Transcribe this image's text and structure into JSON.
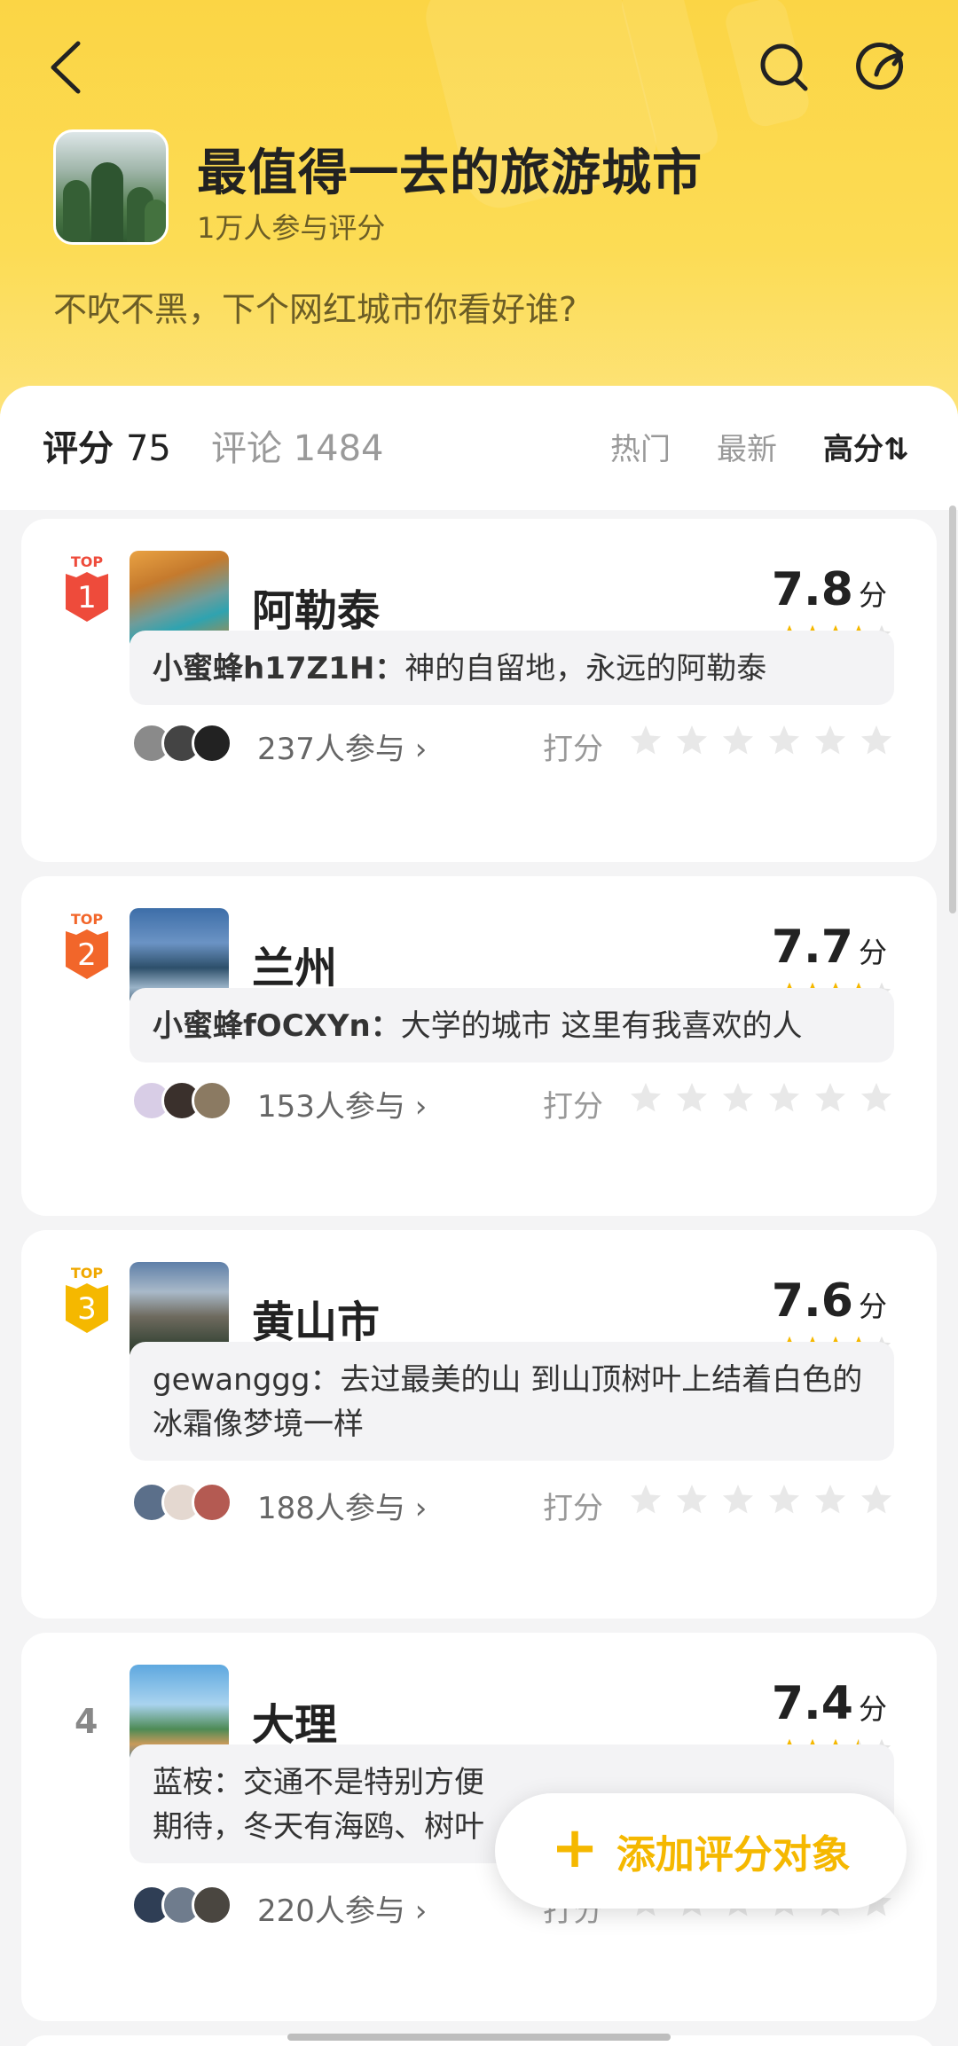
{
  "header": {
    "title": "最值得一去的旅游城市",
    "subtitle": "1万人参与评分",
    "description": "不吹不黑，下个网红城市你看好谁?",
    "icons": {
      "back": "back-arrow-icon",
      "search": "search-icon",
      "share": "share-icon"
    }
  },
  "tabs": {
    "rating_label": "评分",
    "rating_count": "75",
    "comment_label": "评论 1484"
  },
  "sort": {
    "hot": "热门",
    "new": "最新",
    "high": "高分⇅"
  },
  "items": [
    {
      "rank": "1",
      "rank_badge": "TOP",
      "name": "阿勒泰",
      "score": "7.8",
      "score_unit": "分",
      "comment_user": "小蜜蜂h17Z1H：",
      "comment_text": "神的自留地，永远的阿勒泰",
      "participants": "237人参与 ›",
      "rate_label": "打分",
      "star_rating": 4
    },
    {
      "rank": "2",
      "rank_badge": "TOP",
      "name": "兰州",
      "score": "7.7",
      "score_unit": "分",
      "comment_user": "小蜜蜂fOCXYn：",
      "comment_text": "大学的城市 这里有我喜欢的人",
      "participants": "153人参与 ›",
      "rate_label": "打分",
      "star_rating": 4
    },
    {
      "rank": "3",
      "rank_badge": "TOP",
      "name": "黄山市",
      "score": "7.6",
      "score_unit": "分",
      "comment_user": "gewanggg：",
      "comment_text": "去过最美的山 到山顶树叶上结着白色的冰霜像梦境一样",
      "participants": "188人参与 ›",
      "rate_label": "打分",
      "star_rating": 4
    },
    {
      "rank": "4",
      "name": "大理",
      "score": "7.4",
      "score_unit": "分",
      "comment_user": "蓝桉：",
      "comment_text": "交通不是特别方便……期待，冬天有海鸥、树叶……",
      "comment_line1": "交通不是特别方便",
      "comment_line2": "期待，冬天有海鸥、树叶",
      "participants": "220人参与 ›",
      "rate_label": "打分",
      "star_rating": 3.5
    }
  ],
  "fab": {
    "label": "添加评分对象",
    "icon": "plus-icon"
  },
  "colors": {
    "header_yellow": "#fbd545",
    "accent": "#f5b800",
    "rank1": "#ee4b3b",
    "rank2": "#f2662a",
    "rank3": "#f5b800"
  }
}
